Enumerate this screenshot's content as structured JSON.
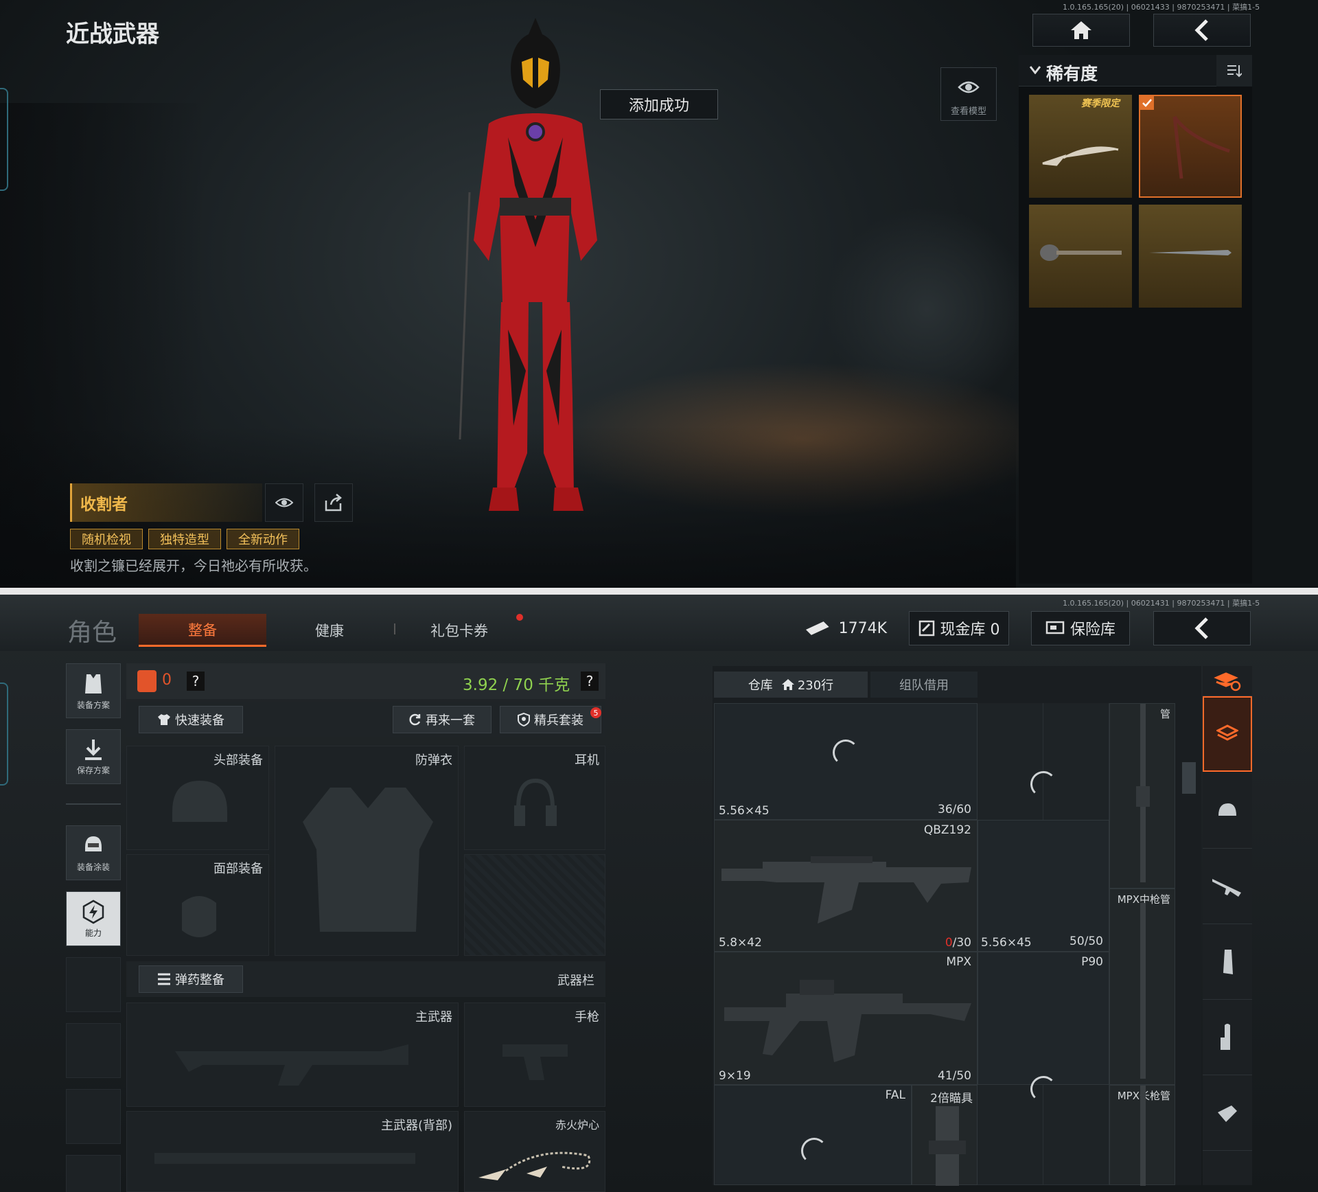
{
  "top": {
    "title": "近战武器",
    "version": "1.0.165.165(20) | 06021433 | 9870253471 | 菜搞1-5",
    "toast": "添加成功",
    "view_model_label": "查看模型",
    "rarity_label": "稀有度",
    "limited_badge": "赛季限定",
    "item_name": "收割者",
    "tags": [
      "随机检视",
      "独特造型",
      "全新动作"
    ],
    "description": "收割之镰已经展开，今日祂必有所收获。"
  },
  "bottom": {
    "version": "1.0.165.165(20) | 06021431 | 9870253471 | 菜搞1-5",
    "role_label": "角色",
    "tabs": [
      "整备",
      "健康",
      "礼包卡券"
    ],
    "currency": "1774K",
    "cash_vault": "现金库 0",
    "safe_box": "保险库",
    "sidebar": [
      "装备方案",
      "保存方案",
      "装备涂装",
      "能力"
    ],
    "armor_count": "0",
    "help": "?",
    "weight": "3.92 / 70 千克",
    "quick_equip": "快速装备",
    "again": "再来一套",
    "elite": "精兵套装",
    "elite_badge": "5",
    "slots": {
      "head": "头部装备",
      "vest": "防弹衣",
      "ear": "耳机",
      "face": "面部装备"
    },
    "ammo_btn": "弹药整备",
    "weapon_bar": "武器栏",
    "weapon_slots": {
      "primary": "主武器",
      "pistol": "手枪",
      "primary_back": "主武器(背部)",
      "melee": "赤火炉心"
    },
    "inventory": {
      "tab_storage": "仓库",
      "rows": "230行",
      "tab_team": "组队借用",
      "cells": [
        {
          "ammo": "5.56×45",
          "count": "36/60"
        },
        {
          "name": "QBZ192",
          "ammo": "5.8×42",
          "count_red": "0",
          "count_rest": "/30"
        },
        {
          "ammo": "5.56×45",
          "count": "50/50",
          "name": "P90"
        },
        {
          "name": "MPX",
          "ammo": "9×19",
          "count": "41/50"
        },
        {
          "name": "FAL"
        },
        {
          "name": "2倍瞄具"
        },
        {
          "name": "MPX中枪管"
        },
        {
          "name": "MPX长枪管"
        },
        {
          "name": "管"
        }
      ]
    }
  },
  "colors": {
    "accent": "#ff6a2a",
    "gold": "#f0b84b",
    "weight_green": "#8fd14f",
    "badge_red": "#e0302a"
  }
}
